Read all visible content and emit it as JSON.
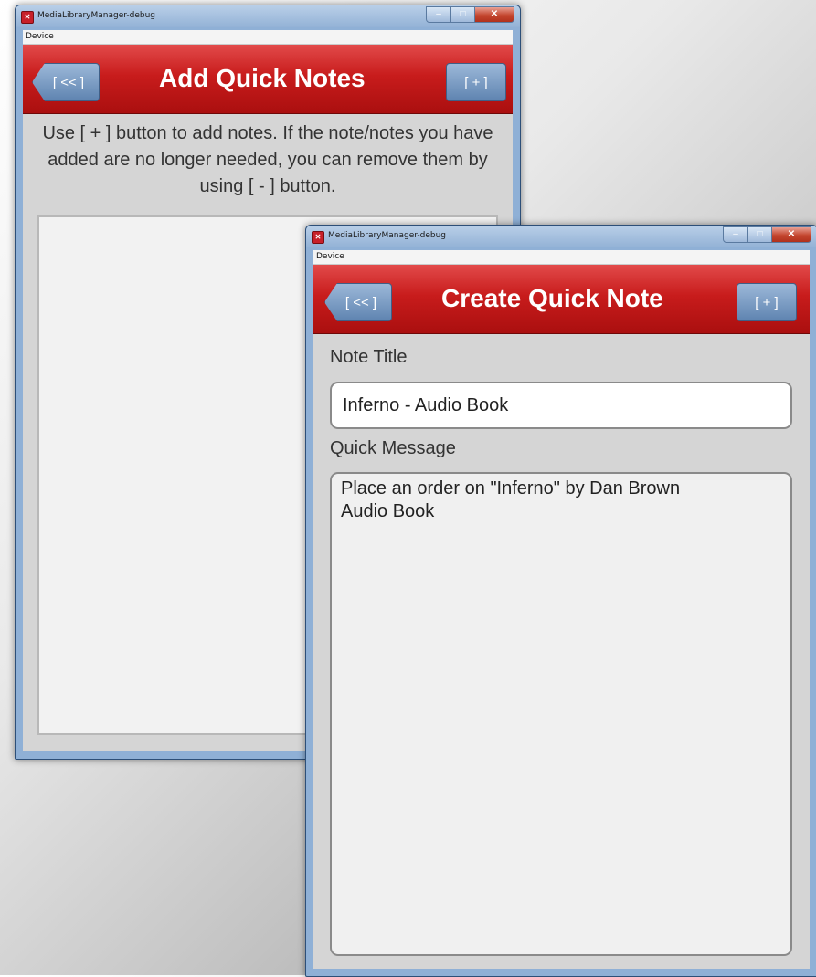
{
  "add_window": {
    "title": "MediaLibraryManager-debug",
    "menu": "Device",
    "header_title": "Add Quick Notes",
    "back_label": "[ << ]",
    "add_label": "[ + ]",
    "instructions": "Use [ + ] button to add notes. If the note/notes you have added are no longer needed, you can remove them by using [ - ] button."
  },
  "create_window": {
    "title": "MediaLibraryManager-debug",
    "menu": "Device",
    "header_title": "Create Quick Note",
    "back_label": "[ << ]",
    "add_label": "[ + ]",
    "note_title_label": "Note Title",
    "note_title_value": "Inferno - Audio Book",
    "quick_message_label": "Quick Message",
    "quick_message_value": "Place an order on \"Inferno\" by Dan Brown\nAudio Book"
  },
  "colors": {
    "header_red": "#c81c1c",
    "button_blue": "#6f92bd",
    "frame_blue": "#8fb0d6"
  }
}
